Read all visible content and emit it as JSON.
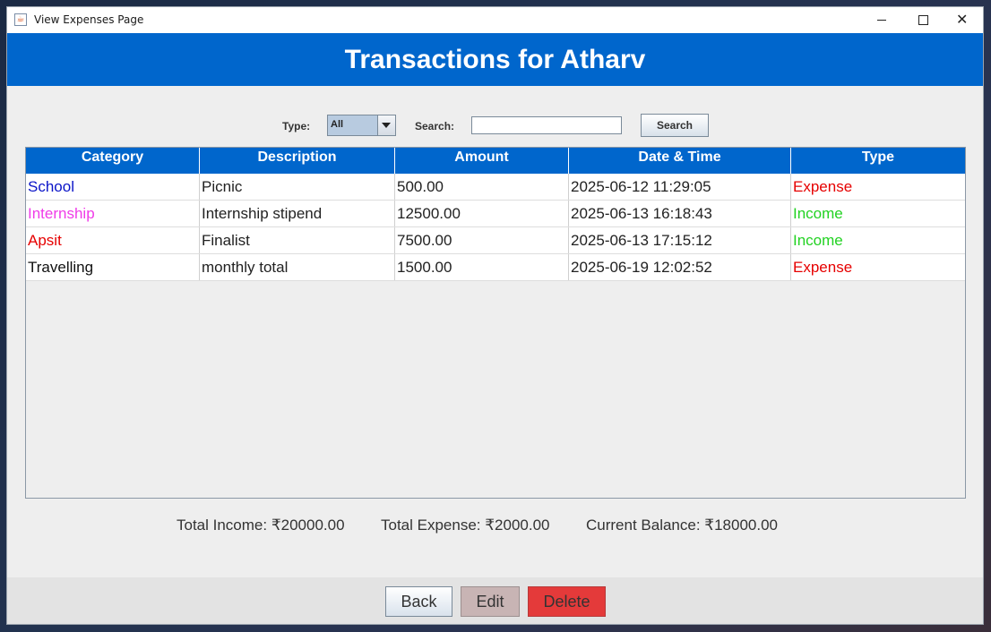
{
  "window": {
    "title": "View Expenses Page",
    "icon": "java-cup-icon"
  },
  "header": {
    "title": "Transactions for Atharv"
  },
  "filters": {
    "type_label": "Type:",
    "type_value": "All",
    "search_label": "Search:",
    "search_value": "",
    "search_button": "Search"
  },
  "table": {
    "columns": [
      "Category",
      "Description",
      "Amount",
      "Date & Time",
      "Type"
    ],
    "rows": [
      {
        "category": "School",
        "category_color": "#0a14c8",
        "description": "Picnic",
        "amount": "500.00",
        "datetime": "2025-06-12 11:29:05",
        "type": "Expense",
        "type_color": "#e60000"
      },
      {
        "category": "Internship",
        "category_color": "#f03ce8",
        "description": "Internship stipend",
        "amount": "12500.00",
        "datetime": "2025-06-13 16:18:43",
        "type": "Income",
        "type_color": "#22d222"
      },
      {
        "category": "Apsit",
        "category_color": "#e60000",
        "description": "Finalist",
        "amount": "7500.00",
        "datetime": "2025-06-13 17:15:12",
        "type": "Income",
        "type_color": "#22d222"
      },
      {
        "category": "Travelling",
        "category_color": "#111111",
        "description": "monthly total",
        "amount": "1500.00",
        "datetime": "2025-06-19 12:02:52",
        "type": "Expense",
        "type_color": "#e60000"
      }
    ]
  },
  "totals": {
    "income": "Total Income: ₹20000.00",
    "expense": "Total Expense: ₹2000.00",
    "balance": "Current Balance: ₹18000.00"
  },
  "buttons": {
    "back": "Back",
    "edit": "Edit",
    "delete": "Delete"
  },
  "colors": {
    "header_bg": "#0066cc",
    "delete_bg": "#e43a3a",
    "edit_bg": "#c8b4b4"
  }
}
